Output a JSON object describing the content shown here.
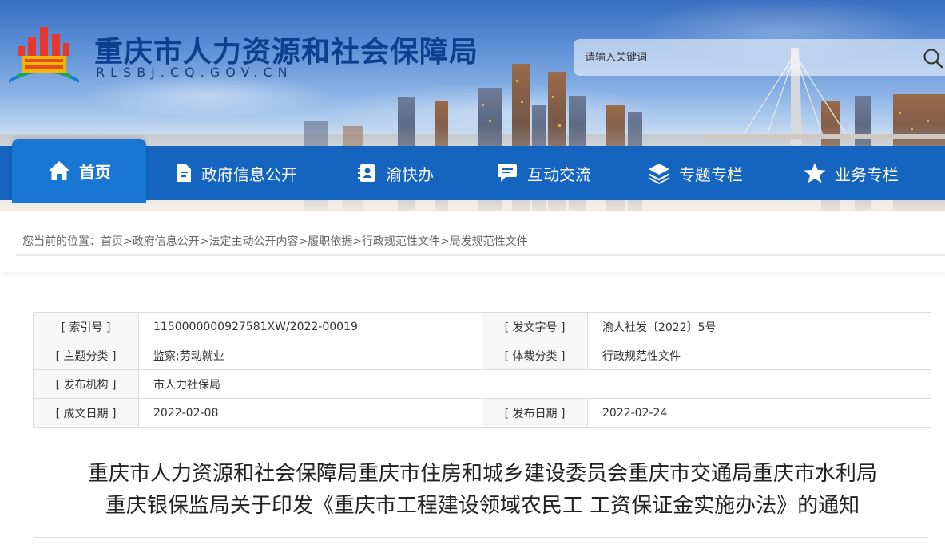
{
  "header": {
    "site_title": "重庆市人力资源和社会保障局",
    "site_domain": "RLSBJ.CQ.GOV.CN",
    "search_placeholder": "请输入关键词"
  },
  "nav": {
    "items": [
      {
        "label": "首页",
        "icon": "home-icon",
        "active": true
      },
      {
        "label": "政府信息公开",
        "icon": "document-icon"
      },
      {
        "label": "渝快办",
        "icon": "contacts-icon"
      },
      {
        "label": "互动交流",
        "icon": "chat-icon"
      },
      {
        "label": "专题专栏",
        "icon": "layers-icon"
      },
      {
        "label": "业务专栏",
        "icon": "star-icon"
      }
    ]
  },
  "breadcrumb": {
    "prefix": "您当前的位置：",
    "items": [
      "首页",
      "政府信息公开",
      "法定主动公开内容",
      "履职依据",
      "行政规范性文件",
      "局发规范性文件"
    ],
    "separator": ">"
  },
  "meta": {
    "rows": [
      {
        "k1": "[ 索引号 ]",
        "v1": "1150000000927581XW/2022-00019",
        "k2": "[ 发文字号 ]",
        "v2": "渝人社发〔2022〕5号"
      },
      {
        "k1": "[ 主题分类 ]",
        "v1": "监察;劳动就业",
        "k2": "[ 体裁分类 ]",
        "v2": "行政规范性文件"
      },
      {
        "k1": "[ 发布机构 ]",
        "v1": "市人力社保局",
        "k2": "",
        "v2": ""
      },
      {
        "k1": "[ 成文日期 ]",
        "v1": "2022-02-08",
        "k2": "[ 发布日期 ]",
        "v2": "2022-02-24"
      }
    ]
  },
  "article": {
    "title_line1": "重庆市人力资源和社会保障局重庆市住房和城乡建设委员会重庆市交通局重庆市水利局",
    "title_line2": "重庆银保监局关于印发《重庆市工程建设领域农民工 工资保证金实施办法》的通知"
  },
  "colors": {
    "nav_bg": "#1565c0",
    "nav_active": "#1976d2",
    "title_blue": "#0d3f8f"
  }
}
